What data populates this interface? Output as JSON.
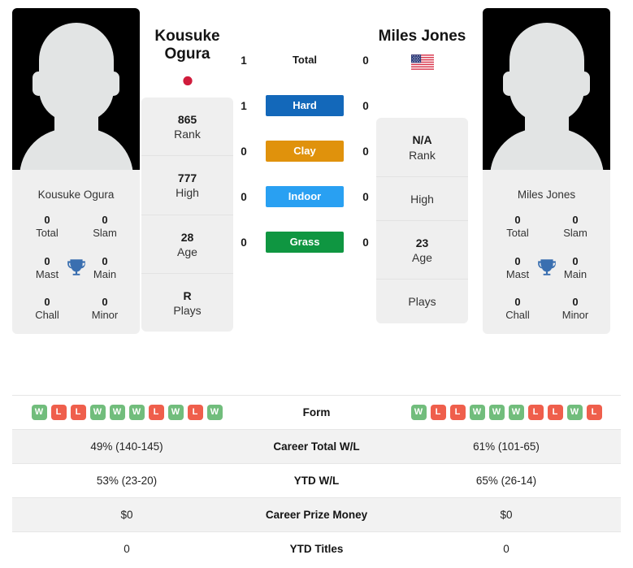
{
  "players": {
    "left": {
      "name_full": "Kousuke Ogura",
      "name_line1": "Kousuke",
      "name_line2": "Ogura",
      "card_name": "Kousuke Ogura",
      "flag": "japan-flag",
      "rank": {
        "value": "865",
        "label": "Rank"
      },
      "high": {
        "value": "777",
        "label": "High"
      },
      "age": {
        "value": "28",
        "label": "Age"
      },
      "plays": {
        "value": "R",
        "label": "Plays"
      },
      "titles": [
        {
          "value": "0",
          "label": "Total"
        },
        {
          "value": "0",
          "label": "Slam"
        },
        {
          "value": "0",
          "label": "Mast"
        },
        {
          "value": "0",
          "label": "Main"
        },
        {
          "value": "0",
          "label": "Chall"
        },
        {
          "value": "0",
          "label": "Minor"
        }
      ],
      "form": [
        "W",
        "L",
        "L",
        "W",
        "W",
        "W",
        "L",
        "W",
        "L",
        "W"
      ],
      "career_total_wl": "49% (140-145)",
      "ytd_wl": "53% (23-20)",
      "career_prize_money": "$0",
      "ytd_titles": "0",
      "h2h": {
        "total": "1",
        "hard": "1",
        "clay": "0",
        "indoor": "0",
        "grass": "0"
      }
    },
    "right": {
      "name_full": "Miles Jones",
      "name_line1": "Miles Jones",
      "name_line2": "",
      "card_name": "Miles Jones",
      "flag": "usa-flag",
      "rank": {
        "value": "N/A",
        "label": "Rank"
      },
      "high": {
        "value": "",
        "label": "High"
      },
      "age": {
        "value": "23",
        "label": "Age"
      },
      "plays": {
        "value": "",
        "label": "Plays"
      },
      "titles": [
        {
          "value": "0",
          "label": "Total"
        },
        {
          "value": "0",
          "label": "Slam"
        },
        {
          "value": "0",
          "label": "Mast"
        },
        {
          "value": "0",
          "label": "Main"
        },
        {
          "value": "0",
          "label": "Chall"
        },
        {
          "value": "0",
          "label": "Minor"
        }
      ],
      "form": [
        "W",
        "L",
        "L",
        "W",
        "W",
        "W",
        "L",
        "L",
        "W",
        "L"
      ],
      "career_total_wl": "61% (101-65)",
      "ytd_wl": "65% (26-14)",
      "career_prize_money": "$0",
      "ytd_titles": "0",
      "h2h": {
        "total": "0",
        "hard": "0",
        "clay": "0",
        "indoor": "0",
        "grass": "0"
      }
    }
  },
  "surfaces": [
    {
      "key": "total",
      "label": "Total",
      "color": "transparent",
      "text_color": "#1a1a1a"
    },
    {
      "key": "hard",
      "label": "Hard",
      "color": "#1368ba",
      "text_color": "#ffffff"
    },
    {
      "key": "clay",
      "label": "Clay",
      "color": "#e0920c",
      "text_color": "#ffffff"
    },
    {
      "key": "indoor",
      "label": "Indoor",
      "color": "#29a0f2",
      "text_color": "#ffffff"
    },
    {
      "key": "grass",
      "label": "Grass",
      "color": "#0f9641",
      "text_color": "#ffffff"
    }
  ],
  "table_rows": [
    {
      "label": "Form",
      "type": "form"
    },
    {
      "label": "Career Total W/L",
      "type": "text",
      "key": "career_total_wl"
    },
    {
      "label": "YTD W/L",
      "type": "text",
      "key": "ytd_wl"
    },
    {
      "label": "Career Prize Money",
      "type": "text",
      "key": "career_prize_money"
    },
    {
      "label": "YTD Titles",
      "type": "text",
      "key": "ytd_titles"
    }
  ],
  "colors": {
    "win_badge": "#71bd7c",
    "loss_badge": "#ef5f4c",
    "trophy": "#3a6fb0",
    "card_bg": "#efefef",
    "row_alt_bg": "#f2f2f2"
  }
}
